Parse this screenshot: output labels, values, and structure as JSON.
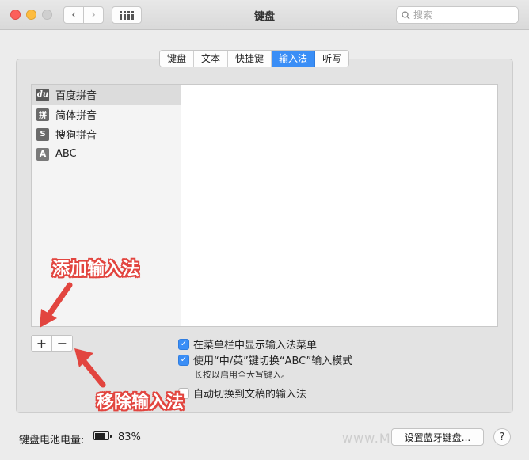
{
  "window": {
    "title": "键盘"
  },
  "search": {
    "placeholder": "搜索"
  },
  "tabs": [
    {
      "label": "键盘",
      "active": false
    },
    {
      "label": "文本",
      "active": false
    },
    {
      "label": "快捷键",
      "active": false
    },
    {
      "label": "输入法",
      "active": true
    },
    {
      "label": "听写",
      "active": false
    }
  ],
  "input_sources": [
    {
      "icon": "du",
      "label": "百度拼音",
      "selected": true
    },
    {
      "icon": "拼",
      "label": "简体拼音",
      "selected": false
    },
    {
      "icon": "S",
      "label": "搜狗拼音",
      "selected": false
    },
    {
      "icon": "A",
      "label": "ABC",
      "selected": false
    }
  ],
  "list_controls": {
    "add": "+",
    "remove": "−"
  },
  "options": {
    "show_menu": {
      "label": "在菜单栏中显示输入法菜单",
      "checked": true
    },
    "switch_abc": {
      "label": "使用“中/英”键切换“ABC”输入模式",
      "checked": true
    },
    "switch_note": "长按以启用全大写键入。",
    "auto_switch": {
      "label": "自动切换到文稿的输入法",
      "checked": false
    }
  },
  "footer": {
    "battery_label": "键盘电池电量:",
    "battery_percent": "83%",
    "battery_level": 0.83,
    "bluetooth_button": "设置蓝牙键盘...",
    "help": "?"
  },
  "annotations": {
    "add_label": "添加输入法",
    "remove_label": "移除输入法"
  },
  "watermark": "www.MacDown.com",
  "colors": {
    "accent": "#3a8ef6",
    "annotation": "#e2453f"
  }
}
